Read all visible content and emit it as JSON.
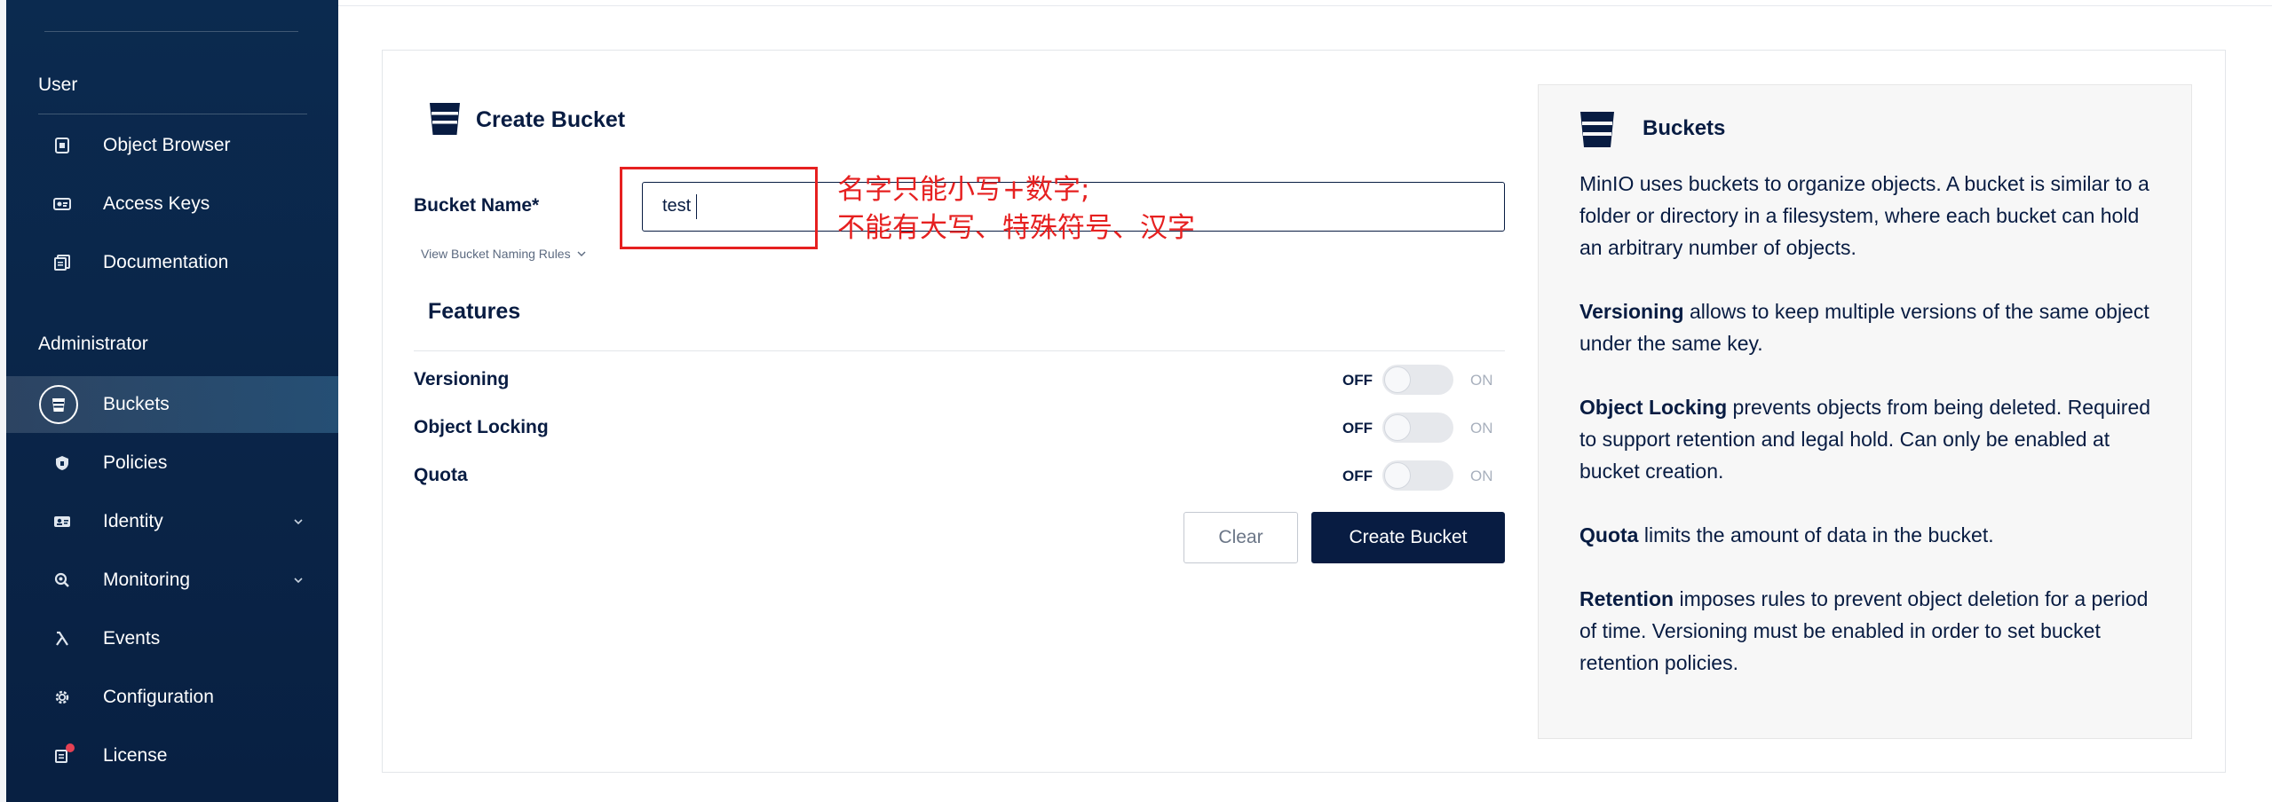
{
  "sidebar": {
    "user_section": "User",
    "user_items": [
      {
        "label": "Object Browser",
        "icon": "object-browser-icon"
      },
      {
        "label": "Access Keys",
        "icon": "access-keys-icon"
      },
      {
        "label": "Documentation",
        "icon": "documentation-icon"
      }
    ],
    "admin_section": "Administrator",
    "admin_items": [
      {
        "label": "Buckets",
        "icon": "bucket-icon",
        "active": true
      },
      {
        "label": "Policies",
        "icon": "policies-icon"
      },
      {
        "label": "Identity",
        "icon": "identity-icon",
        "expandable": true
      },
      {
        "label": "Monitoring",
        "icon": "monitoring-icon",
        "expandable": true
      },
      {
        "label": "Events",
        "icon": "lambda-icon"
      },
      {
        "label": "Configuration",
        "icon": "gear-icon"
      },
      {
        "label": "License",
        "icon": "license-icon",
        "badge": true
      }
    ]
  },
  "form": {
    "title": "Create Bucket",
    "bucket_name_label": "Bucket Name*",
    "bucket_name_value": "test",
    "naming_rules_link": "View Bucket Naming Rules",
    "features_title": "Features",
    "features": [
      {
        "label": "Versioning",
        "off": "OFF",
        "on": "ON",
        "state": "off"
      },
      {
        "label": "Object Locking",
        "off": "OFF",
        "on": "ON",
        "state": "off"
      },
      {
        "label": "Quota",
        "off": "OFF",
        "on": "ON",
        "state": "off"
      }
    ],
    "clear_button": "Clear",
    "create_button": "Create Bucket"
  },
  "annotation": {
    "line1": "名字只能小写+数字;",
    "line2": "不能有大写、特殊符号、汉字",
    "color": "#e62020"
  },
  "help": {
    "title": "Buckets",
    "intro": "MinIO uses buckets to organize objects. A bucket is similar to a folder or directory in a filesystem, where each bucket can hold an arbitrary number of objects.",
    "versioning_term": "Versioning",
    "versioning_text": " allows to keep multiple versions of the same object under the same key.",
    "locking_term": "Object Locking",
    "locking_text": " prevents objects from being deleted. Required to support retention and legal hold. Can only be enabled at bucket creation.",
    "quota_term": "Quota",
    "quota_text": " limits the amount of data in the bucket.",
    "retention_term": "Retention",
    "retention_text": " imposes rules to prevent object deletion for a period of time. Versioning must be enabled in order to set bucket retention policies."
  },
  "colors": {
    "sidebar_bg": "#0b2a4f",
    "primary": "#081c42",
    "annotation": "#e62020",
    "badge": "#e54154"
  }
}
